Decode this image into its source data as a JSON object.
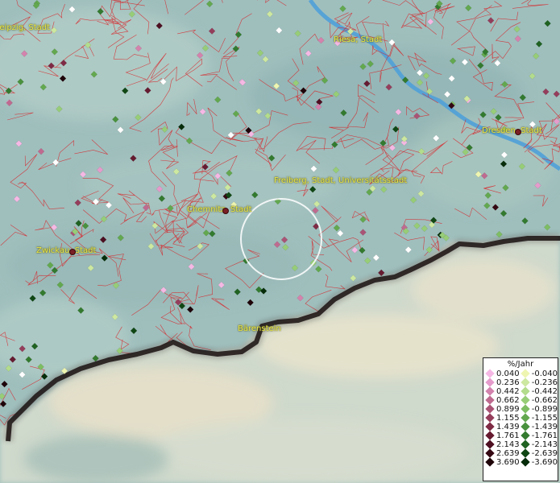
{
  "legend": {
    "title": "%/Jahr",
    "rows": [
      {
        "pos": "0.040",
        "pos_color": "#f5b8e4",
        "neg": "-0.040",
        "neg_color": "#eef5b0"
      },
      {
        "pos": "0.236",
        "pos_color": "#e59ccc",
        "neg": "-0.236",
        "neg_color": "#cde8a0"
      },
      {
        "pos": "0.442",
        "pos_color": "#d383ad",
        "neg": "-0.442",
        "neg_color": "#b3dc8c"
      },
      {
        "pos": "0.662",
        "pos_color": "#bf6b90",
        "neg": "-0.662",
        "neg_color": "#97cd77"
      },
      {
        "pos": "0.899",
        "pos_color": "#aa5475",
        "neg": "-0.899",
        "neg_color": "#7ebd63"
      },
      {
        "pos": "1.155",
        "pos_color": "#953e5c",
        "neg": "-1.155",
        "neg_color": "#63a84f"
      },
      {
        "pos": "1.439",
        "pos_color": "#7f2b45",
        "neg": "-1.439",
        "neg_color": "#4a913e"
      },
      {
        "pos": "1.761",
        "pos_color": "#661b31",
        "neg": "-1.761",
        "neg_color": "#337a2f"
      },
      {
        "pos": "2.143",
        "pos_color": "#4d0f21",
        "neg": "-2.143",
        "neg_color": "#1f6221"
      },
      {
        "pos": "2.639",
        "pos_color": "#340813",
        "neg": "-2.639",
        "neg_color": "#104714"
      },
      {
        "pos": "3.690",
        "pos_color": "#1e0309",
        "neg": "-3.690",
        "neg_color": "#062c09"
      }
    ]
  },
  "cities": [
    {
      "name": "Leipzig, Stadt"
    },
    {
      "name": "Riesa, Stadt"
    },
    {
      "name": "Dresden, Stadt"
    },
    {
      "name": "Freiberg, Stadt, Universitätsstadt"
    },
    {
      "name": "Chemnitz, Stadt"
    },
    {
      "name": "Zwickau, Stadt"
    },
    {
      "name": "Bärenstein"
    }
  ],
  "colors": {
    "border_lines": "#d8262b",
    "river": "#4fa0d8",
    "terrain": "#9fbfbd",
    "country_border": "#1a1414",
    "label_text": "#e7e64a"
  }
}
